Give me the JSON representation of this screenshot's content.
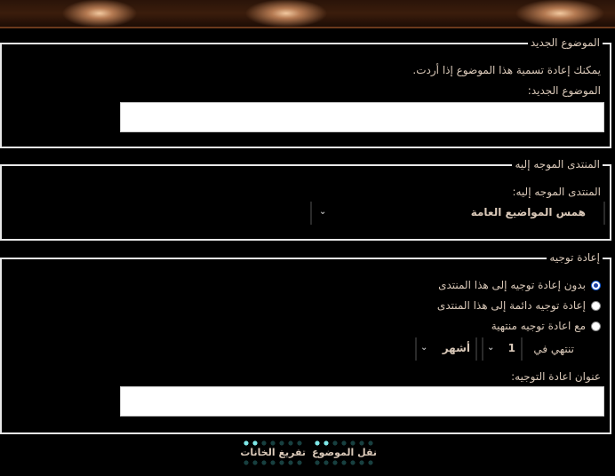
{
  "section_new_title": {
    "legend": "الموضوع الجديد",
    "help_text": "يمكنك إعادة تسمية هذا الموضوع إذا أردت.",
    "field_label": "الموضوع الجديد:",
    "field_value": ""
  },
  "section_target_forum": {
    "legend": "المنتدى الموجه إليه",
    "field_label": "المنتدى الموجه إليه:",
    "selected_forum": "همس المواضيع العامة"
  },
  "section_redirect": {
    "legend": "إعادة توجيه",
    "options": [
      {
        "label": "بدون إعادة توجيه إلى هذا المنتدى",
        "checked": true
      },
      {
        "label": "إعادة توجيه دائمة إلى هذا المنتدى",
        "checked": false
      },
      {
        "label": "مع اعادة توجيه منتهية",
        "checked": false
      }
    ],
    "expires_label": "تنتهي في",
    "expires_amount": "1",
    "expires_unit": "أشهر",
    "title_label": "عنوان اعادة التوجيه:",
    "title_value": ""
  },
  "buttons": {
    "move_thread": "نقل الموضوع",
    "clear_fields": "تفريغ الخانات"
  },
  "colors": {
    "background": "#000000",
    "text": "#d9c8b8",
    "border": "#e8e8e8",
    "dot_lit": "#7ee8e8",
    "dot_dim": "#173f3f"
  }
}
